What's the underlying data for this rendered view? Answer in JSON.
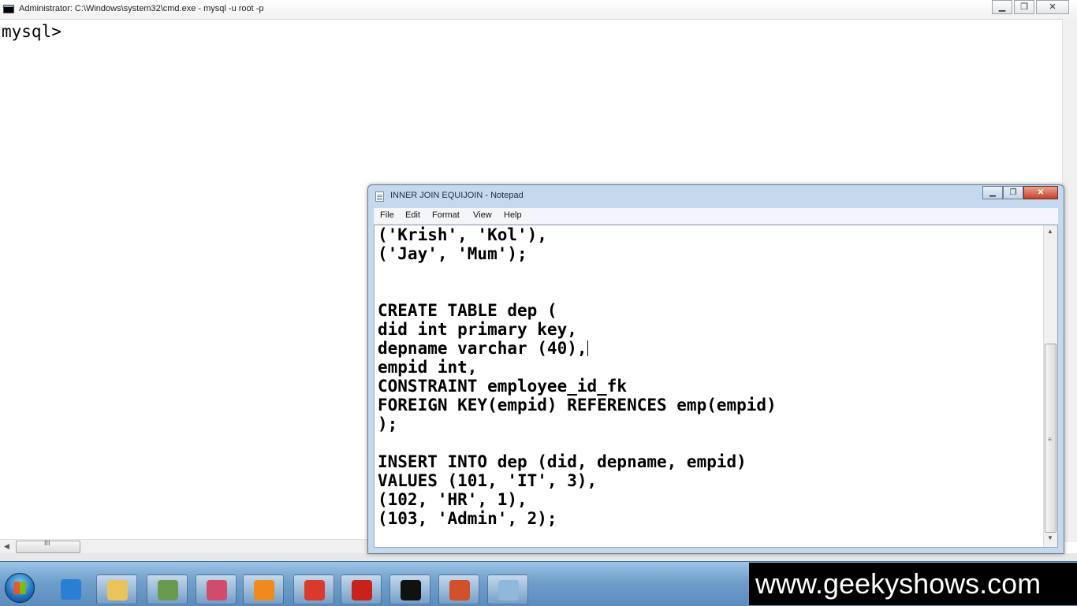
{
  "cmd": {
    "title": "Administrator: C:\\Windows\\system32\\cmd.exe - mysql  -u root -p",
    "prompt": "mysql>",
    "buttons": {
      "minimize": "▁",
      "maximize": "❐",
      "close": "✕"
    },
    "hscroll_grip": "III"
  },
  "notepad": {
    "title": "INNER JOIN EQUIJOIN - Notepad",
    "buttons": {
      "minimize": "▁",
      "maximize": "❐",
      "close": "✕"
    },
    "menu": [
      "File",
      "Edit",
      "Format",
      "View",
      "Help"
    ],
    "lines": [
      "('Krish', 'Kol'),",
      "('Jay', 'Mum');",
      "",
      "",
      "CREATE TABLE dep (",
      "did int primary key,",
      "depname varchar (40),",
      "empid int,",
      "CONSTRAINT employee_id_fk",
      "FOREIGN KEY(empid) REFERENCES emp(empid)",
      ");",
      "",
      "INSERT INTO dep (did, depname, empid)",
      "VALUES (101, 'IT', 3),",
      "(102, 'HR', 1),",
      "(103, 'Admin', 2);"
    ],
    "caret_line": 6
  },
  "taskbar": {
    "items": [
      {
        "name": "internet-explorer-icon",
        "color": "#2a7fd4"
      },
      {
        "name": "file-explorer-icon",
        "color": "#e8c45a"
      },
      {
        "name": "book-reader-icon",
        "color": "#6a9a4f"
      },
      {
        "name": "snipping-tool-icon",
        "color": "#d24b6b"
      },
      {
        "name": "media-player-icon",
        "color": "#f08a1c"
      },
      {
        "name": "chrome-icon",
        "color": "#d93a2b"
      },
      {
        "name": "acrobat-reader-icon",
        "color": "#c8221c"
      },
      {
        "name": "command-prompt-icon",
        "color": "#111111"
      },
      {
        "name": "powerpoint-icon",
        "color": "#d2502a"
      },
      {
        "name": "notepad-icon",
        "color": "#8fb8dc"
      }
    ]
  },
  "watermark": "www.geekyshows.com"
}
